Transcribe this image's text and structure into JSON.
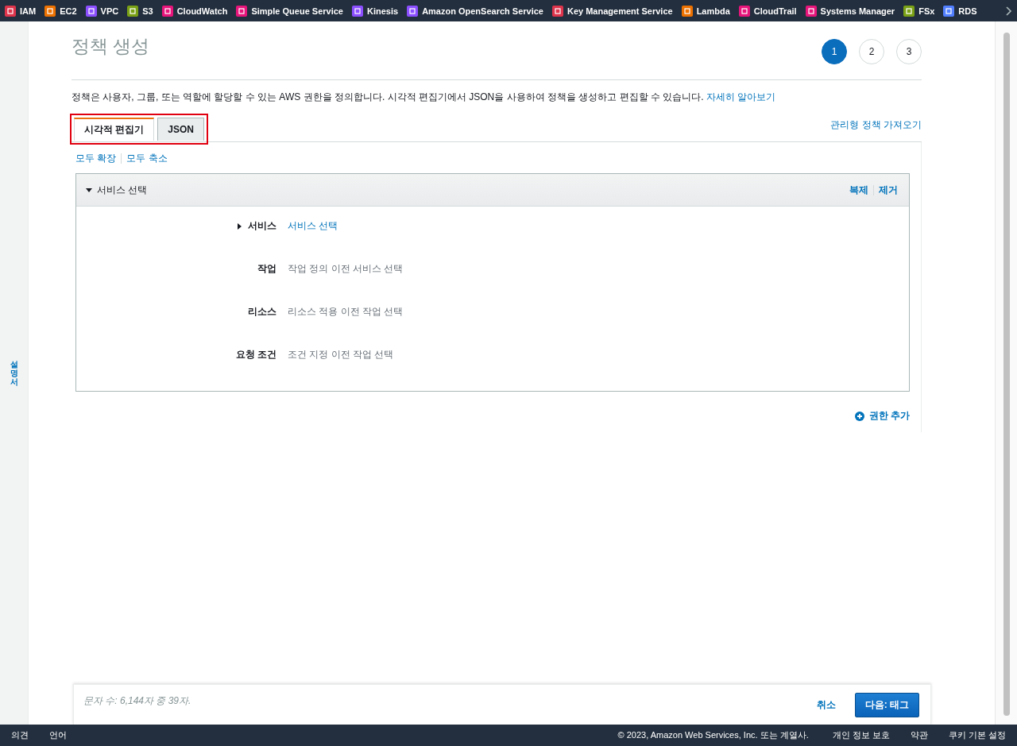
{
  "favorites": [
    {
      "label": "IAM",
      "color": "#dd344c"
    },
    {
      "label": "EC2",
      "color": "#ed7100"
    },
    {
      "label": "VPC",
      "color": "#8c4fff"
    },
    {
      "label": "S3",
      "color": "#7aa116"
    },
    {
      "label": "CloudWatch",
      "color": "#e7157b"
    },
    {
      "label": "Simple Queue Service",
      "color": "#e7157b"
    },
    {
      "label": "Kinesis",
      "color": "#8c4fff"
    },
    {
      "label": "Amazon OpenSearch Service",
      "color": "#8c4fff"
    },
    {
      "label": "Key Management Service",
      "color": "#dd344c"
    },
    {
      "label": "Lambda",
      "color": "#ed7100"
    },
    {
      "label": "CloudTrail",
      "color": "#e7157b"
    },
    {
      "label": "Systems Manager",
      "color": "#e7157b"
    },
    {
      "label": "FSx",
      "color": "#7aa116"
    },
    {
      "label": "RDS",
      "color": "#527fff"
    }
  ],
  "sidebar": {
    "label": "설명서"
  },
  "page": {
    "title": "정책 생성",
    "steps": [
      {
        "label": "1",
        "selected": true
      },
      {
        "label": "2",
        "selected": false
      },
      {
        "label": "3",
        "selected": false
      }
    ],
    "description": "정책은 사용자, 그룹, 또는 역할에 할당할 수 있는 AWS 권한을 정의합니다. 시각적 편집기에서 JSON을 사용하여 정책을 생성하고 편집할 수 있습니다.",
    "learn_more": "자세히 알아보기",
    "tabs": [
      {
        "label": "시각적 편집기",
        "selected": true
      },
      {
        "label": "JSON",
        "selected": false
      }
    ],
    "tabs_highlighted": true,
    "import_link": "관리형 정책 가져오기",
    "expand_all": "모두 확장",
    "collapse_all": "모두 축소",
    "section": {
      "title": "서비스 선택",
      "expanded": true,
      "actions": [
        "복제",
        "제거"
      ],
      "rows": [
        {
          "label": "서비스",
          "kind": "link",
          "expandable": true,
          "value": "서비스 선택"
        },
        {
          "label": "작업",
          "kind": "hint",
          "expandable": false,
          "value": "작업 정의 이전 서비스 선택"
        },
        {
          "label": "리소스",
          "kind": "hint",
          "expandable": false,
          "value": "리소스 적용 이전 작업 선택"
        },
        {
          "label": "요청 조건",
          "kind": "hint",
          "expandable": false,
          "value": "조건 지정 이전 작업 선택"
        }
      ]
    },
    "add_permission": "권한 추가"
  },
  "action_bar": {
    "char_count": "문자 수: 6,144자 중 39자.",
    "cancel": "취소",
    "next": "다음: 태그"
  },
  "footer": {
    "left": [
      "의견",
      "언어"
    ],
    "copyright": "© 2023, Amazon Web Services, Inc. 또는 계열사.",
    "links": [
      "개인 정보 보호",
      "약관",
      "쿠키 기본 설정"
    ]
  }
}
